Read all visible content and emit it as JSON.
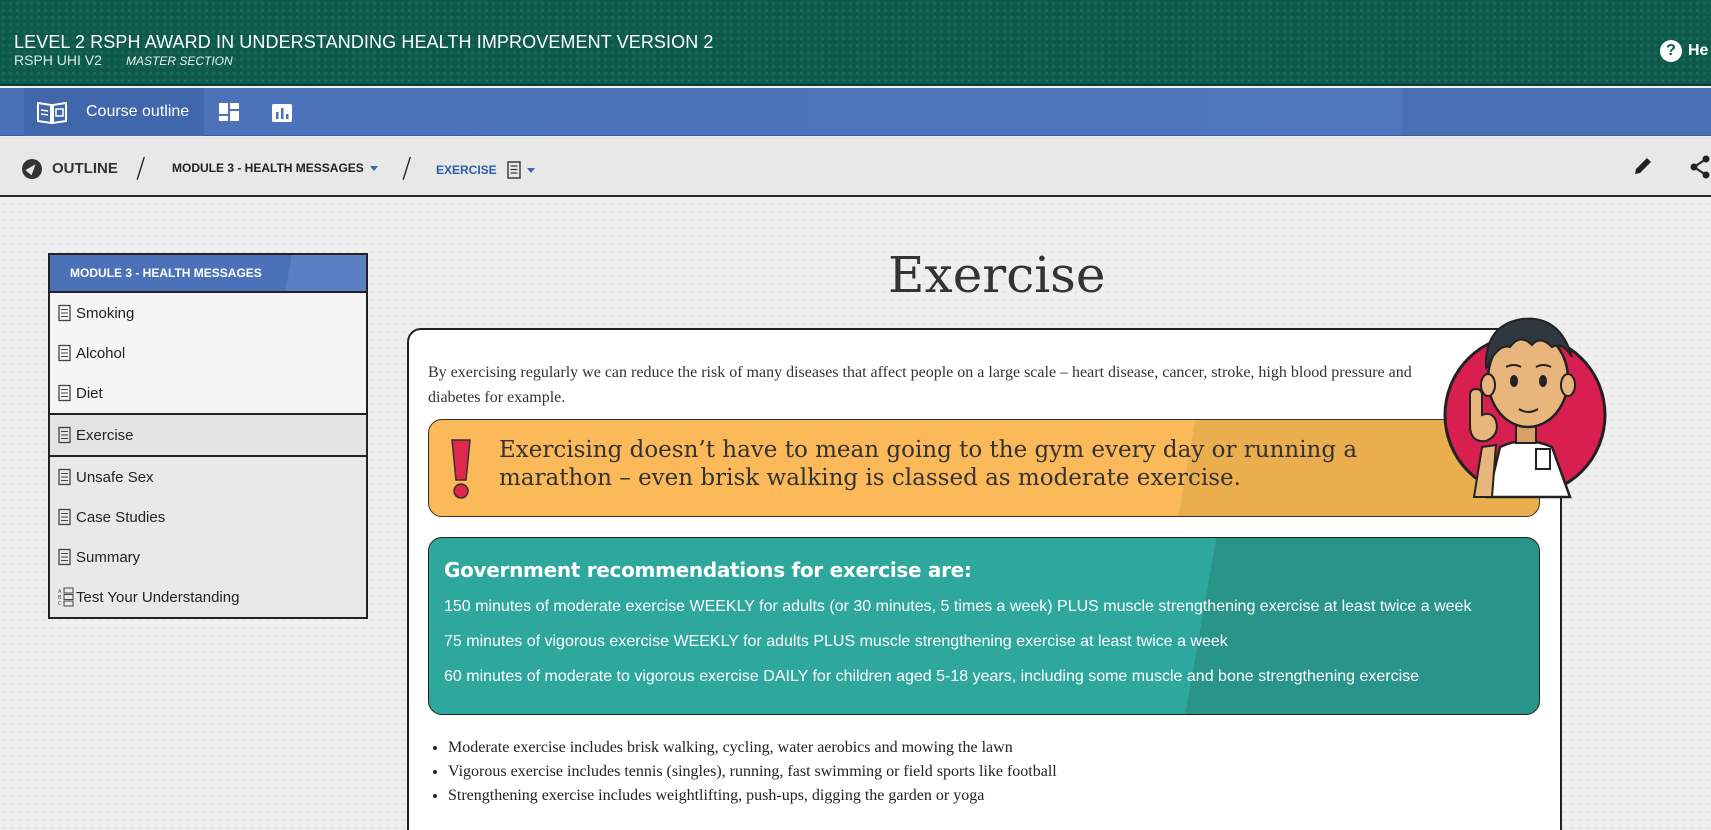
{
  "header": {
    "course_title": "LEVEL 2 RSPH AWARD IN UNDERSTANDING HEALTH IMPROVEMENT VERSION 2",
    "course_code": "RSPH UHI V2",
    "section": "MASTER SECTION",
    "help_label": "He"
  },
  "nav": {
    "course_outline": "Course outline"
  },
  "breadcrumb": {
    "outline": "OUTLINE",
    "separator": "/",
    "module": "MODULE 3 - HEALTH MESSAGES",
    "current": "EXERCISE"
  },
  "sidebar": {
    "heading": "MODULE 3 - HEALTH MESSAGES",
    "items": [
      {
        "label": "Smoking",
        "icon": "document-icon"
      },
      {
        "label": "Alcohol",
        "icon": "document-icon"
      },
      {
        "label": "Diet",
        "icon": "document-icon"
      },
      {
        "label": "Exercise",
        "icon": "document-icon"
      },
      {
        "label": "Unsafe Sex",
        "icon": "document-icon"
      },
      {
        "label": "Case Studies",
        "icon": "document-icon"
      },
      {
        "label": "Summary",
        "icon": "document-icon"
      },
      {
        "label": "Test Your Understanding",
        "icon": "quiz-icon"
      }
    ],
    "active_index": 3
  },
  "main": {
    "title": "Exercise",
    "intro": "By exercising regularly we can reduce the risk of many diseases that affect people on a large scale – heart disease, cancer, stroke, high blood pressure and diabetes for example.",
    "callout": "Exercising doesn’t have to mean going to the gym every day or running a marathon – even brisk walking is classed as moderate exercise.",
    "recommendations": {
      "title": "Government recommendations for exercise are:",
      "lines": [
        "150 minutes of moderate exercise WEEKLY for adults (or 30 minutes, 5 times a week) PLUS muscle strengthening exercise at least twice a week",
        "75 minutes of vigorous exercise WEEKLY for adults PLUS muscle strengthening exercise at least twice a week",
        "60 minutes of moderate to vigorous exercise DAILY for children aged 5-18 years, including some muscle and bone strengthening exercise"
      ]
    },
    "bullets": [
      "Moderate exercise includes brisk walking, cycling, water aerobics and mowing the lawn",
      "Vigorous exercise includes tennis (singles), running, fast swimming or field sports like football",
      "Strengthening exercise includes weightlifting, push-ups, digging the garden or yoga"
    ]
  },
  "colors": {
    "header_green": "#0d5a4c",
    "nav_blue": "#4b72b9",
    "callout_orange": "#fbb95a",
    "recs_teal": "#2ea89c",
    "mascot_red": "#d81f4f"
  }
}
